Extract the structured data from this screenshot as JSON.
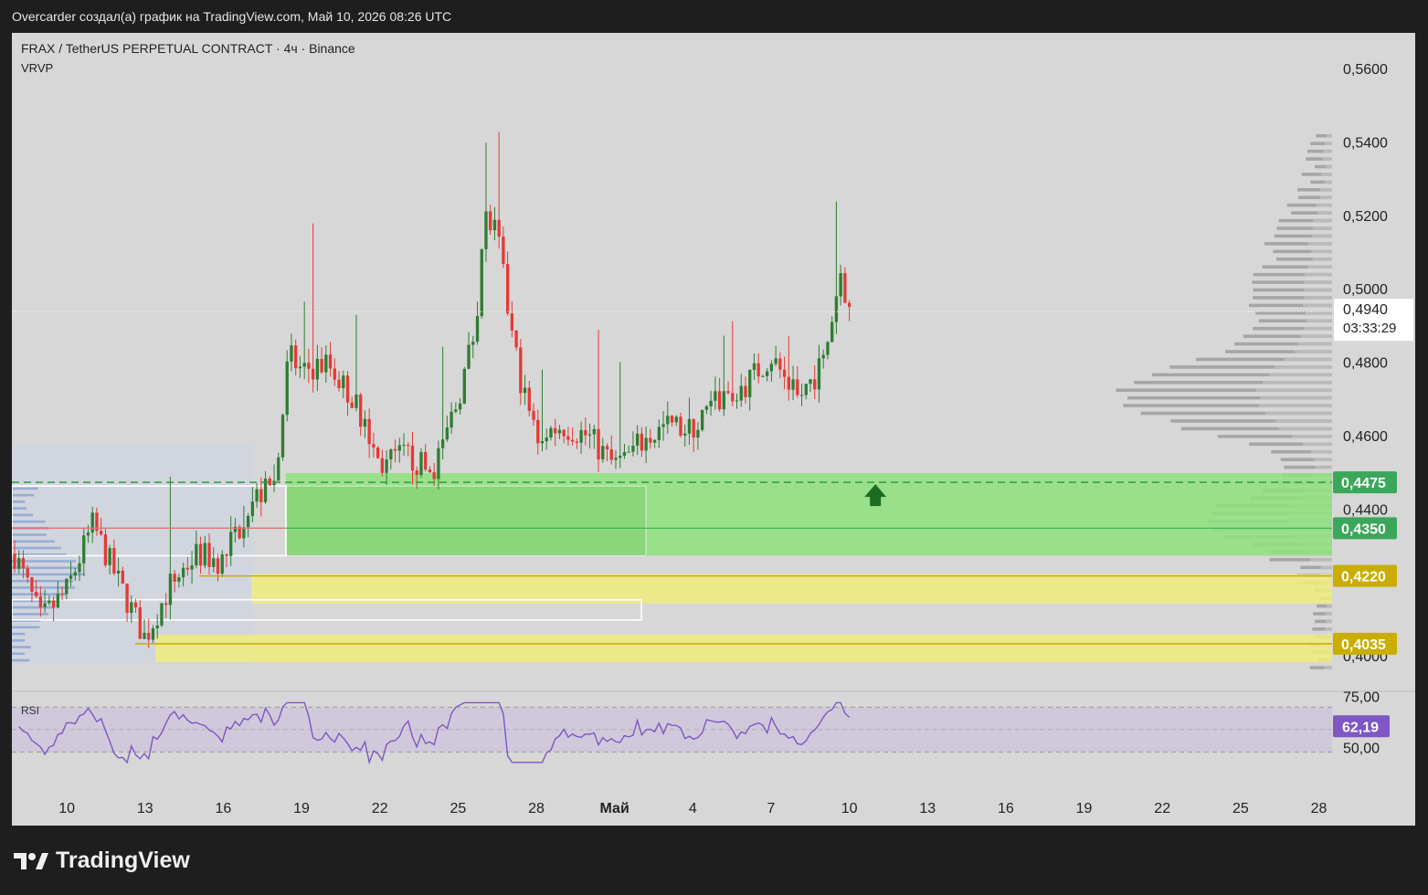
{
  "header": {
    "caption": "Overcarder создал(а) график на TradingView.com, Май 10, 2026 08:26 UTC"
  },
  "chart_title": {
    "symbol": "FRAX / TetherUS PERPETUAL CONTRACT · 4ч · Binance",
    "indicator": "VRVP"
  },
  "rsi_panel": {
    "label": "RSI",
    "value_label": "62,19",
    "levels": [
      "75,00",
      "50,00"
    ]
  },
  "price_axis": {
    "ticks": [
      "0,5600",
      "0,5400",
      "0,5200",
      "0,5000",
      "0,4800",
      "0,4600",
      "0,4400",
      "0,4000"
    ],
    "current_price": "0,4940",
    "countdown": "03:33:29",
    "levels": [
      {
        "label": "0,4475",
        "color": "#3aa75a"
      },
      {
        "label": "0,4350",
        "color": "#3aa75a"
      },
      {
        "label": "0,4220",
        "color": "#c9ad00"
      },
      {
        "label": "0,4035",
        "color": "#c9ad00"
      }
    ]
  },
  "time_axis": {
    "ticks": [
      "10",
      "13",
      "16",
      "19",
      "22",
      "25",
      "28",
      "Май",
      "4",
      "7",
      "10",
      "13",
      "16",
      "19",
      "22",
      "25",
      "28"
    ]
  },
  "footer": {
    "brand": "TradingView"
  },
  "colors": {
    "up": "#2e7d32",
    "down": "#e53935",
    "green_zone": "#8fe27c",
    "yellow_zone": "#f0ec7e",
    "rsi_line": "#7e57c2"
  },
  "chart_data": {
    "type": "candlestick",
    "symbol": "FRAX/USDT",
    "timeframe": "4h",
    "y_range": [
      0.395,
      0.565
    ],
    "x_range_dates": [
      "2026-04-08",
      "2026-05-28"
    ],
    "data_start": "2026-04-08",
    "data_end": "2026-05-10",
    "current_price": 0.494,
    "levels": [
      0.4475,
      0.435,
      0.422,
      0.4035
    ],
    "zones": [
      {
        "from": 0.4275,
        "to": 0.45,
        "color": "green"
      },
      {
        "from": 0.4145,
        "to": 0.4225,
        "color": "yellow"
      },
      {
        "from": 0.3985,
        "to": 0.406,
        "color": "yellow"
      }
    ],
    "rsi_levels": [
      75,
      50
    ],
    "rsi_last": 62.19,
    "waypoints": [
      [
        "2026-04-08",
        0.428
      ],
      [
        "2026-04-09",
        0.41
      ],
      [
        "2026-04-10",
        0.418
      ],
      [
        "2026-04-11",
        0.436
      ],
      [
        "2026-04-12",
        0.42
      ],
      [
        "2026-04-13",
        0.405
      ],
      [
        "2026-04-14",
        0.42
      ],
      [
        "2026-04-15",
        0.428
      ],
      [
        "2026-04-16",
        0.426
      ],
      [
        "2026-04-17",
        0.442
      ],
      [
        "2026-04-18",
        0.447
      ],
      [
        "2026-04-18T12",
        0.482
      ],
      [
        "2026-04-19",
        0.478
      ],
      [
        "2026-04-20",
        0.48
      ],
      [
        "2026-04-21",
        0.47
      ],
      [
        "2026-04-22",
        0.452
      ],
      [
        "2026-04-23",
        0.455
      ],
      [
        "2026-04-24",
        0.45
      ],
      [
        "2026-04-25",
        0.47
      ],
      [
        "2026-04-25T16",
        0.49
      ],
      [
        "2026-04-26",
        0.52
      ],
      [
        "2026-04-26T12",
        0.515
      ],
      [
        "2026-04-27",
        0.49
      ],
      [
        "2026-04-27T12",
        0.472
      ],
      [
        "2026-04-28",
        0.46
      ],
      [
        "2026-04-29",
        0.463
      ],
      [
        "2026-04-30",
        0.46
      ],
      [
        "2026-05-01",
        0.452
      ],
      [
        "2026-05-02",
        0.458
      ],
      [
        "2026-05-03",
        0.463
      ],
      [
        "2026-05-04",
        0.462
      ],
      [
        "2026-05-05",
        0.47
      ],
      [
        "2026-05-06",
        0.474
      ],
      [
        "2026-05-07",
        0.482
      ],
      [
        "2026-05-08",
        0.47
      ],
      [
        "2026-05-09",
        0.48
      ],
      [
        "2026-05-09T16",
        0.505
      ],
      [
        "2026-05-10",
        0.494
      ]
    ]
  }
}
